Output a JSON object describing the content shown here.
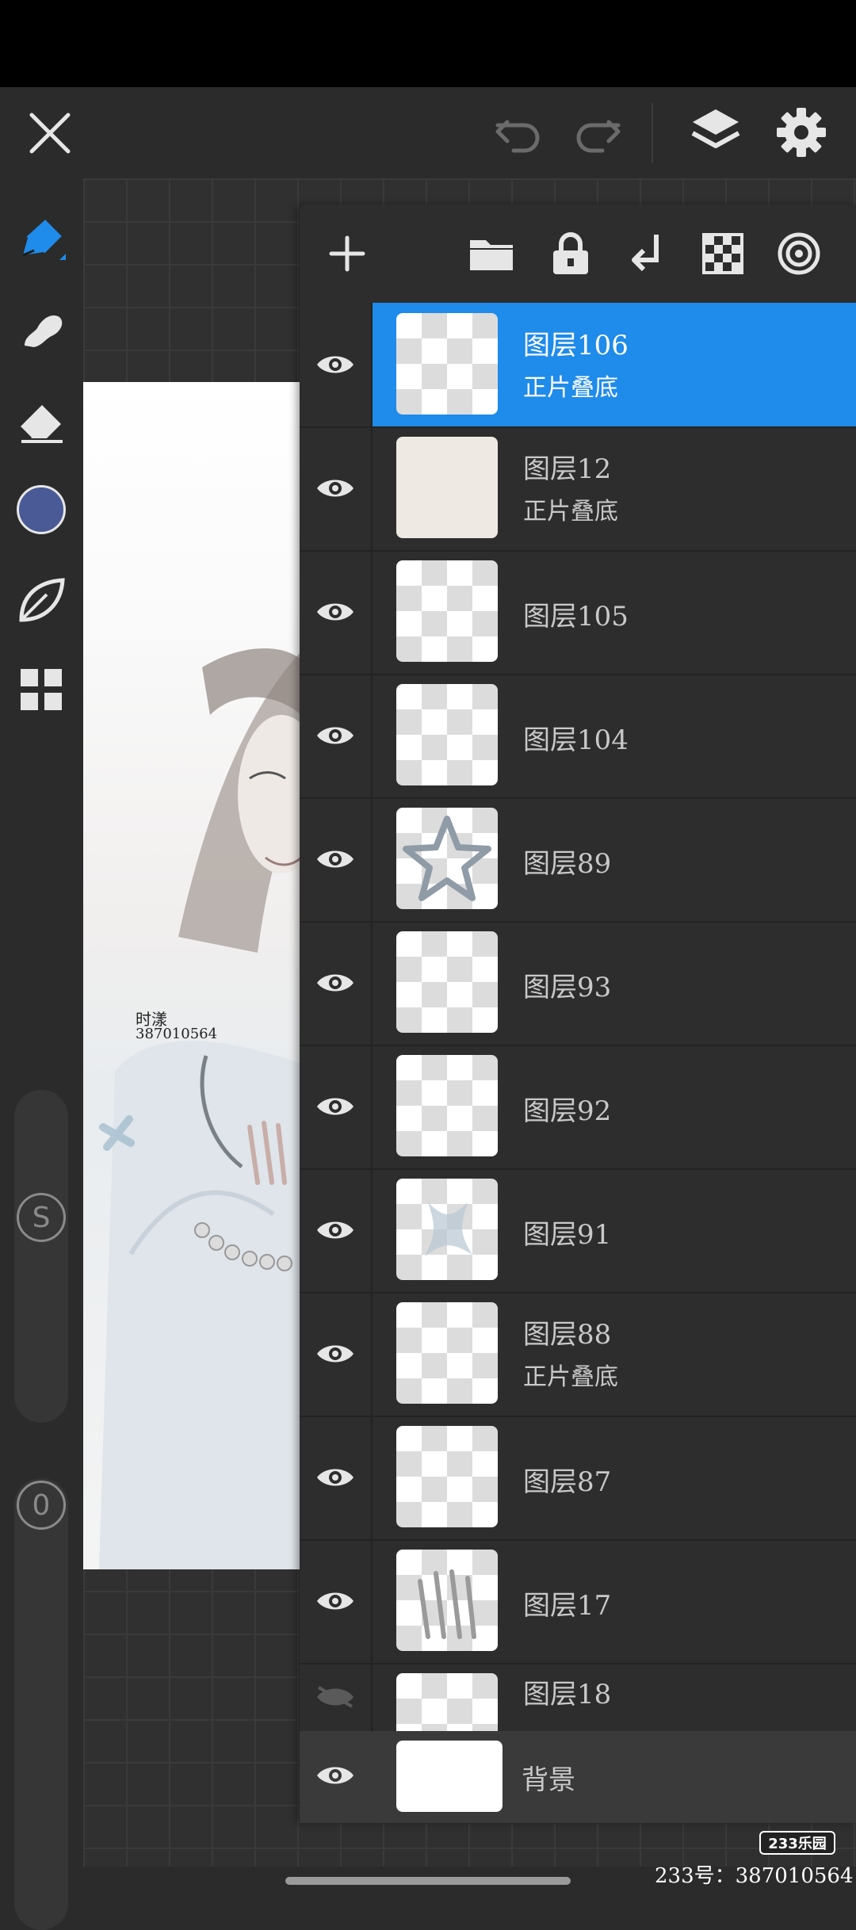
{
  "topbar": {
    "close_icon": "close-icon",
    "undo_icon": "undo-icon",
    "redo_icon": "redo-icon",
    "layers_icon": "layers-icon",
    "settings_icon": "gear-icon"
  },
  "left_toolbar": {
    "tools": [
      "pen-icon",
      "smudge-icon",
      "eraser-icon",
      "color-swatch",
      "leaf-icon",
      "grid-icon"
    ],
    "current_color": "#4a5a96",
    "size_slider_label": "S",
    "opacity_slider_label": "0"
  },
  "artwork": {
    "signature_name": "时漾",
    "signature_id": "387010564"
  },
  "layer_panel": {
    "accent_color": "#1f8bea",
    "toolbar": [
      "add-icon",
      "folder-icon",
      "lock-icon",
      "merge-down-icon",
      "transparency-icon",
      "blend-icon"
    ],
    "layers": [
      {
        "name": "图层106",
        "mode": "正片叠底",
        "selected": true
      },
      {
        "name": "图层12",
        "mode": "正片叠底"
      },
      {
        "name": "图层105",
        "mode": ""
      },
      {
        "name": "图层104",
        "mode": ""
      },
      {
        "name": "图层89",
        "mode": ""
      },
      {
        "name": "图层93",
        "mode": ""
      },
      {
        "name": "图层92",
        "mode": ""
      },
      {
        "name": "图层91",
        "mode": ""
      },
      {
        "name": "图层88",
        "mode": "正片叠底"
      },
      {
        "name": "图层87",
        "mode": ""
      },
      {
        "name": "图层17",
        "mode": ""
      },
      {
        "name": "图层18",
        "mode": ""
      }
    ],
    "background_layer": "背景"
  },
  "watermark": {
    "logo": "233乐园",
    "text": "233号：387010564"
  }
}
